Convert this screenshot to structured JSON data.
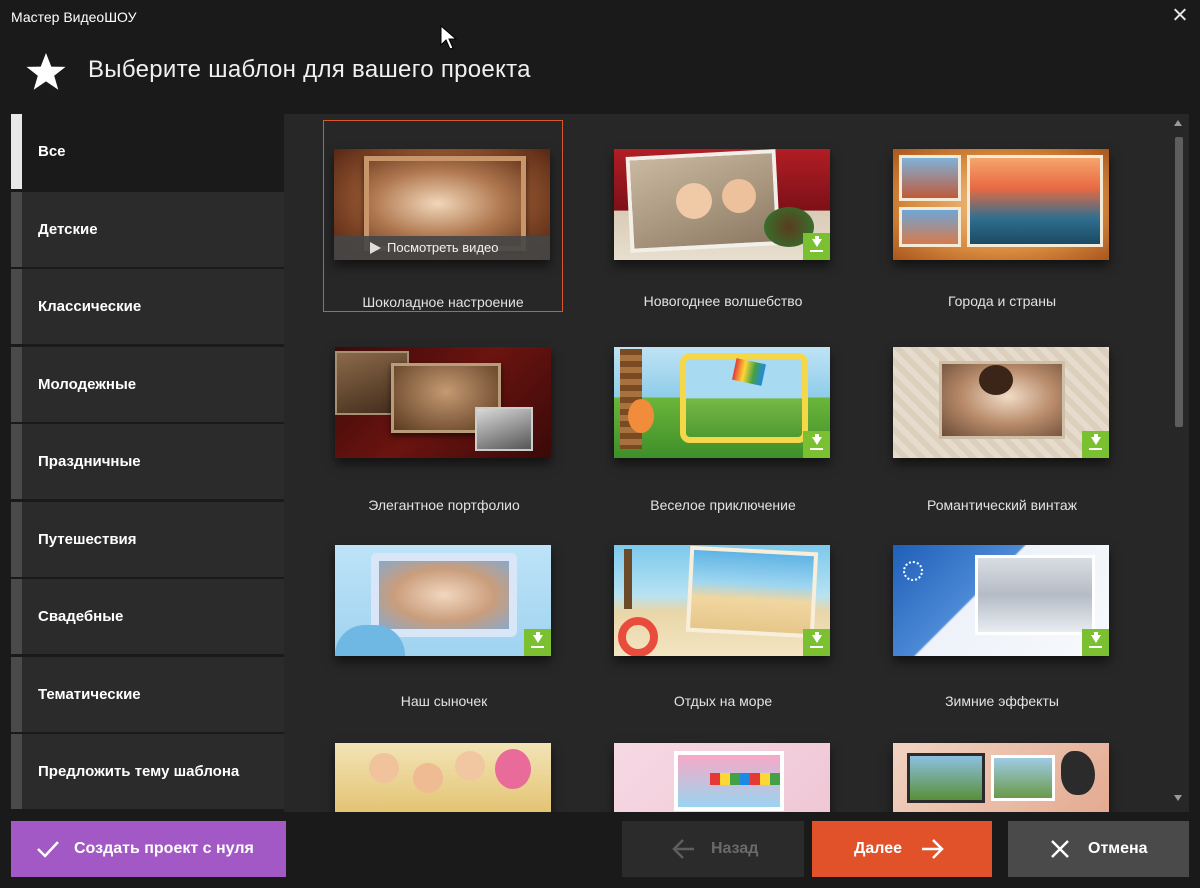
{
  "window": {
    "title": "Мастер ВидеоШОУ"
  },
  "header": {
    "title": "Выберите шаблон для вашего проекта",
    "icon": "star-icon"
  },
  "sidebar": {
    "items": [
      {
        "label": "Все",
        "active": true
      },
      {
        "label": "Детские",
        "active": false
      },
      {
        "label": "Классические",
        "active": false
      },
      {
        "label": "Молодежные",
        "active": false
      },
      {
        "label": "Праздничные",
        "active": false
      },
      {
        "label": "Путешествия",
        "active": false
      },
      {
        "label": "Свадебные",
        "active": false
      },
      {
        "label": "Тематические",
        "active": false
      },
      {
        "label": "Предложить тему шаблона",
        "active": false
      }
    ]
  },
  "templates": [
    {
      "name": "Шоколадное настроение",
      "selected": true,
      "overlay": "Посмотреть видео",
      "download": false
    },
    {
      "name": "Новогоднее волшебство",
      "selected": false,
      "download": true
    },
    {
      "name": "Города и страны",
      "selected": false,
      "download": false
    },
    {
      "name": "Элегантное портфолио",
      "selected": false,
      "download": false
    },
    {
      "name": "Веселое приключение",
      "selected": false,
      "download": true
    },
    {
      "name": "Романтический винтаж",
      "selected": false,
      "download": true
    },
    {
      "name": "Наш сыночек",
      "selected": false,
      "download": true
    },
    {
      "name": "Отдых на море",
      "selected": false,
      "download": true
    },
    {
      "name": "Зимние эффекты",
      "selected": false,
      "download": true
    },
    {
      "name": "",
      "selected": false,
      "download": false
    },
    {
      "name": "",
      "selected": false,
      "download": false
    },
    {
      "name": "",
      "selected": false,
      "download": false
    }
  ],
  "footer": {
    "create_label": "Создать проект с нуля",
    "back_label": "Назад",
    "next_label": "Далее",
    "cancel_label": "Отмена"
  },
  "colors": {
    "accent_selected": "#d9582b",
    "create_button": "#a259c6",
    "next_button": "#e1522a",
    "download_badge": "#7ac031",
    "window_bg": "#1a1a1a",
    "panel_bg": "#272727"
  }
}
